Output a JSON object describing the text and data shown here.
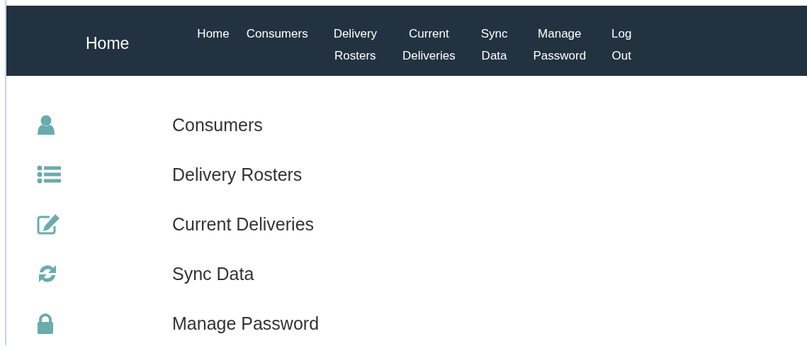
{
  "brand": "Home",
  "nav": [
    {
      "label": "Home"
    },
    {
      "label": "Consumers"
    },
    {
      "label": "Delivery Rosters"
    },
    {
      "label": "Current Deliveries"
    },
    {
      "label": "Sync Data"
    },
    {
      "label": "Manage Password"
    },
    {
      "label": "Log Out"
    }
  ],
  "menu": [
    {
      "kind": "person",
      "label": "Consumers"
    },
    {
      "kind": "list",
      "label": "Delivery Rosters"
    },
    {
      "kind": "edit",
      "label": "Current Deliveries"
    },
    {
      "kind": "sync",
      "label": "Sync Data"
    },
    {
      "kind": "lock",
      "label": "Manage Password"
    }
  ]
}
